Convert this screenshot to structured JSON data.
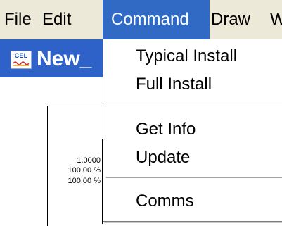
{
  "menubar": {
    "items": [
      {
        "label": "File"
      },
      {
        "label": "Edit"
      },
      {
        "label": "Command"
      },
      {
        "label": "Draw"
      },
      {
        "label": "W"
      }
    ]
  },
  "window": {
    "icon_text": "CEL",
    "title": "New_"
  },
  "document": {
    "values": [
      "1.0000",
      "100.00 %",
      "100.00 %"
    ]
  },
  "dropdown": {
    "items": [
      "Typical Install",
      "Full Install",
      "Get Info",
      "Update",
      "Comms"
    ]
  },
  "colors": {
    "menubar_bg": "#ece9d8",
    "highlight": "#316ac5",
    "titlebar": "#2f62c8"
  }
}
